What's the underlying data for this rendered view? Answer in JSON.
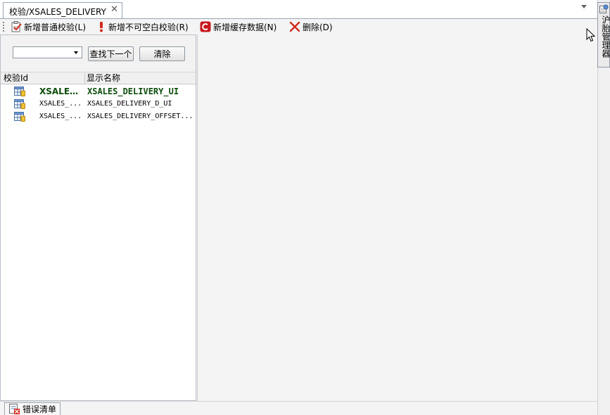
{
  "document_tab": {
    "title": "校验/XSALES_DELIVERY",
    "close_glyph": "✕"
  },
  "toolbar": {
    "add_normal_label": "新增普通校验(L)",
    "add_nonempty_label": "新增不可空白校验(R)",
    "add_cache_label": "新增缓存数据(N)",
    "delete_label": "删除(D)"
  },
  "search": {
    "combo_value": "",
    "find_next_label": "查找下一个",
    "clear_label": "清除"
  },
  "grid": {
    "columns": [
      "校验Id",
      "显示名称"
    ],
    "rows": [
      {
        "id": "XSALES...",
        "name": "XSALES_DELIVERY_UI",
        "selected": true
      },
      {
        "id": "XSALES_...",
        "name": "XSALES_DELIVERY_D_UI",
        "selected": false
      },
      {
        "id": "XSALES_...",
        "name": "XSALES_DELIVERY_OFFSET...",
        "selected": false
      }
    ]
  },
  "bottom": {
    "error_list_label": "错误清单"
  },
  "side_panel": {
    "label": "沪胎管理器"
  },
  "icons": {
    "add_normal": "checklist-icon",
    "add_nonempty": "exclamation-icon",
    "add_cache": "cache-c-icon",
    "delete": "delete-x-icon",
    "row": "table-grid-icon",
    "error_list": "error-list-icon"
  },
  "colors": {
    "selected_row_text": "#0b4d0b",
    "delete_icon": "#d12b1d",
    "cache_icon": "#c8161d",
    "exclamation_icon": "#d12b1d"
  }
}
